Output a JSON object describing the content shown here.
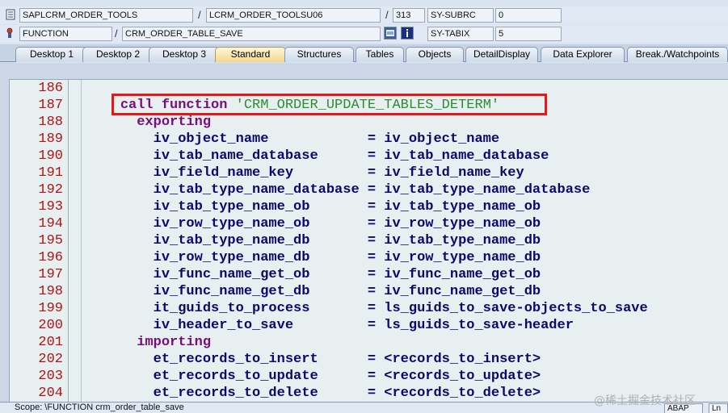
{
  "header": {
    "row1": {
      "program": "SAPLCRM_ORDER_TOOLS",
      "sep1": "/",
      "include": "LCRM_ORDER_TOOLSU06",
      "sep2": "/",
      "line_no": "313",
      "sysvar": "SY-SUBRC",
      "sysval": "0"
    },
    "row2": {
      "type": "FUNCTION",
      "sep1": "/",
      "name": "CRM_ORDER_TABLE_SAVE",
      "sysvar": "SY-TABIX",
      "sysval": "5"
    }
  },
  "tabs": [
    {
      "label": "Desktop 1",
      "active": false
    },
    {
      "label": "Desktop 2",
      "active": false
    },
    {
      "label": "Desktop 3",
      "active": false
    },
    {
      "label": "Standard",
      "active": true
    },
    {
      "label": "Structures",
      "active": false
    },
    {
      "label": "Tables",
      "active": false
    },
    {
      "label": "Objects",
      "active": false
    },
    {
      "label": "DetailDisplay",
      "active": false
    },
    {
      "label": "Data Explorer",
      "active": false
    },
    {
      "label": "Break./Watchpoints",
      "active": false
    }
  ],
  "code_lines": [
    {
      "n": "186",
      "segs": []
    },
    {
      "n": "187",
      "segs": [
        {
          "t": "    ",
          "c": ""
        },
        {
          "t": "call function ",
          "c": "kw"
        },
        {
          "t": "'CRM_ORDER_UPDATE_TABLES_DETERM'",
          "c": "str"
        }
      ]
    },
    {
      "n": "188",
      "segs": [
        {
          "t": "      ",
          "c": ""
        },
        {
          "t": "exporting",
          "c": "kw"
        }
      ]
    },
    {
      "n": "189",
      "segs": [
        {
          "t": "        iv_object_name            = iv_object_name",
          "c": ""
        }
      ]
    },
    {
      "n": "190",
      "segs": [
        {
          "t": "        iv_tab_name_database      = iv_tab_name_database",
          "c": ""
        }
      ]
    },
    {
      "n": "191",
      "segs": [
        {
          "t": "        iv_field_name_key         = iv_field_name_key",
          "c": ""
        }
      ]
    },
    {
      "n": "192",
      "segs": [
        {
          "t": "        iv_tab_type_name_database = iv_tab_type_name_database",
          "c": ""
        }
      ]
    },
    {
      "n": "193",
      "segs": [
        {
          "t": "        iv_tab_type_name_ob       = iv_tab_type_name_ob",
          "c": ""
        }
      ]
    },
    {
      "n": "194",
      "segs": [
        {
          "t": "        iv_row_type_name_ob       = iv_row_type_name_ob",
          "c": ""
        }
      ]
    },
    {
      "n": "195",
      "segs": [
        {
          "t": "        iv_tab_type_name_db       = iv_tab_type_name_db",
          "c": ""
        }
      ]
    },
    {
      "n": "196",
      "segs": [
        {
          "t": "        iv_row_type_name_db       = iv_row_type_name_db",
          "c": ""
        }
      ]
    },
    {
      "n": "197",
      "segs": [
        {
          "t": "        iv_func_name_get_ob       = iv_func_name_get_ob",
          "c": ""
        }
      ]
    },
    {
      "n": "198",
      "segs": [
        {
          "t": "        iv_func_name_get_db       = iv_func_name_get_db",
          "c": ""
        }
      ]
    },
    {
      "n": "199",
      "segs": [
        {
          "t": "        it_guids_to_process       = ls_guids_to_save-objects_to_save",
          "c": ""
        }
      ]
    },
    {
      "n": "200",
      "segs": [
        {
          "t": "        iv_header_to_save         = ls_guids_to_save-header",
          "c": ""
        }
      ]
    },
    {
      "n": "201",
      "segs": [
        {
          "t": "      ",
          "c": ""
        },
        {
          "t": "importing",
          "c": "kw"
        }
      ]
    },
    {
      "n": "202",
      "segs": [
        {
          "t": "        et_records_to_insert      = <records_to_insert>",
          "c": ""
        }
      ]
    },
    {
      "n": "203",
      "segs": [
        {
          "t": "        et_records_to_update      = <records_to_update>",
          "c": ""
        }
      ]
    },
    {
      "n": "204",
      "segs": [
        {
          "t": "        et_records_to_delete      = <records_to_delete>",
          "c": ""
        }
      ]
    }
  ],
  "status": {
    "scope": "Scope: \\FUNCTION crm_order_table_save",
    "lang": "ABAP",
    "pos": "Ln"
  },
  "watermark": "@稀土掘金技术社区",
  "colors": {
    "highlight_box": "#e0191b",
    "line_number": "#b01414",
    "keyword": "#7a0d7a",
    "string": "#2f8d2f",
    "identifier": "#0a0a6e",
    "active_tab": "#f2d889"
  }
}
